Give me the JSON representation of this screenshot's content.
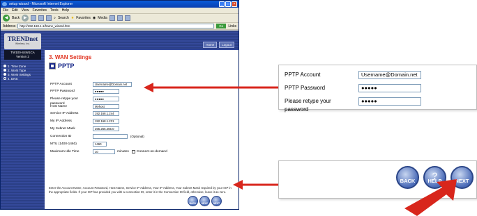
{
  "browser": {
    "title": "setup wizard - Microsoft Internet Explorer",
    "menu": [
      "File",
      "Edit",
      "View",
      "Favorites",
      "Tools",
      "Help"
    ],
    "toolbar": {
      "back": "Back",
      "search": "Search",
      "favorites": "Favorites",
      "media": "Media"
    },
    "address_label": "Address",
    "address_value": "http://192.168.1.1/frame_wizard.htm",
    "go_label": "Go",
    "links_label": "Links"
  },
  "sidebar": {
    "logo": "TRENDnet",
    "logo_sub": "Wireless, Inc.",
    "model": "TW100-S4W1CA",
    "version": "Version 2",
    "items": [
      {
        "label": "1. Time Zone",
        "active": true
      },
      {
        "label": "2. WAN Type",
        "active": true
      },
      {
        "label": "3. WAN Settings",
        "active": true
      },
      {
        "label": "4. DNS",
        "active": false
      }
    ]
  },
  "header": {
    "home": "Home",
    "logout": "Logout"
  },
  "main": {
    "title": "3. WAN Settings",
    "subtitle": "PPTP",
    "fields": [
      {
        "label": "PPTP Account",
        "value": "Username@Domain.net"
      },
      {
        "label": "PPTP Password",
        "value": "●●●●●"
      },
      {
        "label": "Please retype your password",
        "value": "●●●●●"
      },
      {
        "label": "Host Name",
        "value": "Myhost"
      },
      {
        "label": "Service IP Address",
        "value": "192.168.1.244"
      },
      {
        "label": "My IP Address",
        "value": "192.168.1.231"
      },
      {
        "label": "My Subnet Mask",
        "value": "255.255.255.0"
      },
      {
        "label": "Connection ID",
        "value": ""
      },
      {
        "label": "MTU (1400-1460)",
        "value": "1460"
      },
      {
        "label": "Maximum Idle Time",
        "value": "10"
      }
    ],
    "connection_id_optional": "(Optional)",
    "idle_suffix": "minutes",
    "connect_on_demand": "Connect-on-demand",
    "note": "Enter the Account Name, Account Password, Host Name, Service IP Address, Your IP Address, Your Subnet Mask required by your ISP in the appropriate fields. If your ISP has provided you with a connection ID, enter it in the Connection ID field, otherwise, leave it as zero.",
    "buttons": {
      "back": "BACK",
      "help": "HELP",
      "next": "NEXT"
    }
  },
  "callout_fields": [
    {
      "label": "PPTP Account",
      "value": "Username@Domain.net"
    },
    {
      "label": "PPTP Password",
      "value": "●●●●●"
    },
    {
      "label": "Please retype your password",
      "value": "●●●●●"
    }
  ],
  "callout_buttons": {
    "back": "BACK",
    "help": "HELP",
    "next": "NEXT",
    "help_glyph": "?"
  },
  "colors": {
    "arrow": "#d8261c",
    "nav": "#2b3f86",
    "accent": "#e0321f"
  }
}
